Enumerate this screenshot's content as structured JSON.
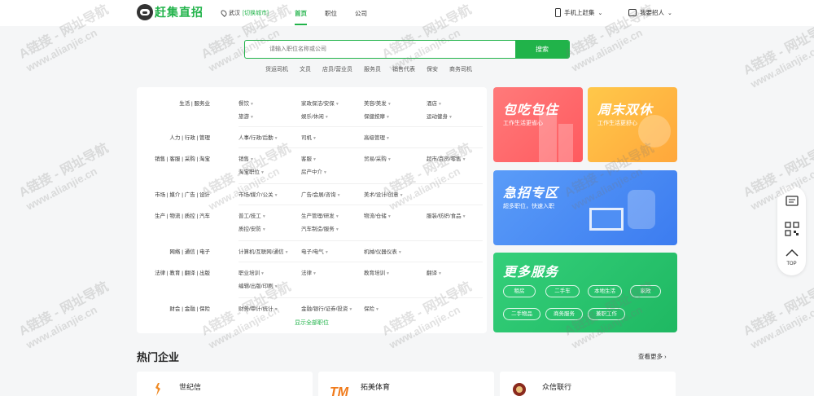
{
  "header": {
    "logo_text": "赶集直招",
    "city": "武汉",
    "switch_city": "[切换城市]",
    "nav": [
      "首页",
      "职位",
      "公司"
    ],
    "mobile_label": "手机上赶集",
    "recruit_label": "我要招人"
  },
  "search": {
    "placeholder": "请输入职位名称或公司",
    "button_label": "搜索",
    "hot_tags": [
      "货运司机",
      "文员",
      "店员/营业员",
      "服务员",
      "销售代表",
      "保安",
      "商务司机"
    ]
  },
  "categories": [
    {
      "label": "生活 | 服务业",
      "items": [
        "餐饮",
        "家政保洁/安保",
        "美容/美发",
        "酒店",
        "旅游",
        "娱乐/休闲",
        "保健按摩",
        "运动健身"
      ]
    },
    {
      "label": "人力 | 行政 | 管理",
      "items": [
        "人事/行政/后勤",
        "司机",
        "高级管理"
      ]
    },
    {
      "label": "销售 | 客服 | 采购 | 淘宝",
      "items": [
        "销售",
        "客服",
        "贸易/采购",
        "超市/百货/零售",
        "淘宝职位",
        "房产中介"
      ]
    },
    {
      "label": "市场 | 媒介 | 广告 | 设计",
      "items": [
        "市场/媒介/公关",
        "广告/会展/咨询",
        "美术/设计/创意"
      ]
    },
    {
      "label": "生产 | 物流 | 质控 | 汽车",
      "items": [
        "普工/技工",
        "生产管理/研发",
        "物流/仓储",
        "服装/纺织/食品",
        "质控/安防",
        "汽车制造/服务"
      ]
    },
    {
      "label": "网络 | 通信 | 电子",
      "items": [
        "计算机/互联网/通信",
        "电子/电气",
        "机械/仪器仪表"
      ]
    },
    {
      "label": "法律 | 教育 | 翻译 | 出版",
      "items": [
        "职业培训",
        "法律",
        "教育培训",
        "翻译",
        "编辑/出版/印刷"
      ]
    },
    {
      "label": "财会 | 金融 | 保险",
      "items": [
        "财务/审计/统计",
        "金融/银行/证券/投资",
        "保险"
      ]
    }
  ],
  "show_all_label": "显示全部职位",
  "promos": {
    "p1_title": "包吃包住",
    "p1_sub": "工作生活更省心",
    "p2_title": "周末双休",
    "p2_sub": "工作生活更舒心",
    "p3_title": "急招专区",
    "p3_sub": "超多职位，快速入职",
    "p4_title": "更多服务",
    "services": [
      "租房",
      "二手车",
      "本地生活",
      "家政",
      "二手物品",
      "商务服务",
      "兼职工作"
    ]
  },
  "hot_companies": {
    "title": "热门企业",
    "more_label": "查看更多",
    "companies": [
      "世纪信",
      "拓美体育",
      "众信联行"
    ]
  },
  "side": {
    "top_label": "TOP"
  },
  "watermark": {
    "line1": "A链接 - 网址导航",
    "line2": "www.alianjie.cn"
  },
  "colors": {
    "brand": "#21b34a"
  }
}
